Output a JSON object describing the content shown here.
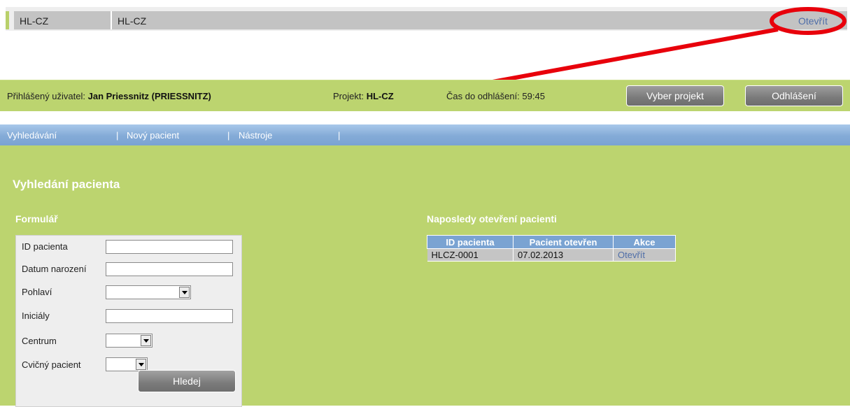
{
  "top_strip": {
    "cell_code": "HL-CZ",
    "cell_name": "HL-CZ",
    "open_link": "Otevřít"
  },
  "header": {
    "user_label": "Přihlášený uživatel: ",
    "user_name": "Jan Priessnitz (PRIESSNITZ)",
    "project_label": "Projekt: ",
    "project_name": "HL-CZ",
    "logout_timer": "Čas do odhlášení: 59:45",
    "select_project_button": "Vyber projekt",
    "logout_button": "Odhlášení"
  },
  "nav": {
    "items": [
      {
        "label": "Vyhledávání"
      },
      {
        "label": "Nový pacient"
      },
      {
        "label": "Nástroje"
      }
    ],
    "separator": "|"
  },
  "page": {
    "title": "Vyhledání pacienta",
    "form_title": "Formulář",
    "recent_title": "Naposledy otevření pacienti"
  },
  "form": {
    "fields": {
      "patient_id": {
        "label": "ID pacienta",
        "value": ""
      },
      "birth_date": {
        "label": "Datum narození",
        "value": ""
      },
      "sex": {
        "label": "Pohlaví",
        "value": ""
      },
      "initials": {
        "label": "Iniciály",
        "value": ""
      },
      "center": {
        "label": "Centrum",
        "value": ""
      },
      "test_patient": {
        "label": "Cvičný pacient",
        "value": ""
      }
    },
    "search_button": "Hledej"
  },
  "recent_table": {
    "headers": [
      "ID pacienta",
      "Pacient otevřen",
      "Akce"
    ],
    "rows": [
      {
        "id": "HLCZ-0001",
        "opened": "07.02.2013",
        "action": "Otevřít"
      }
    ]
  },
  "colors": {
    "header_green": "#bcd46f",
    "nav_blue": "#7aa3d2",
    "link_blue": "#4f6ea8",
    "annotation_red": "#e8000b"
  }
}
